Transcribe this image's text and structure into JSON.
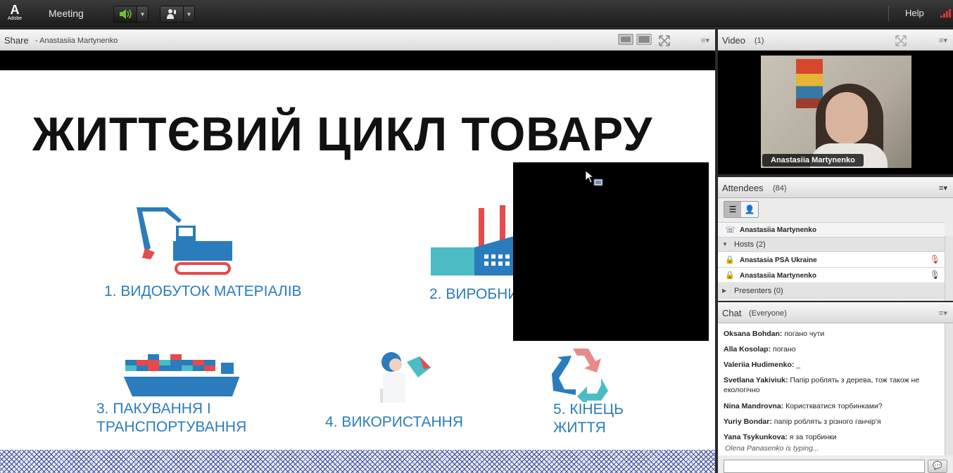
{
  "topbar": {
    "logo_text": "Adobe",
    "meeting_menu": "Meeting",
    "help_menu": "Help",
    "icons": {
      "speaker": "speaker-icon",
      "presenter": "raise-hand-icon",
      "signal": "connection-signal-icon"
    }
  },
  "share": {
    "title": "Share",
    "subtitle": "- Anastasiia Martynenko",
    "slide_title": "ЖИТТЄВИЙ ЦИКЛ ТОВАРУ",
    "stages": [
      {
        "label": "1. ВИДОБУТОК МАТЕРІАЛІВ"
      },
      {
        "label": "2. ВИРОБНИ"
      },
      {
        "label_line1": "3. ПАКУВАННЯ І",
        "label_line2": "ТРАНСПОРТУВАННЯ"
      },
      {
        "label": "4. ВИКОРИСТАННЯ"
      },
      {
        "label_line1": "5. КІНЕЦЬ",
        "label_line2": "ЖИТТЯ"
      }
    ]
  },
  "video": {
    "title": "Video",
    "count": "(1)",
    "name_tag": "Anastasiia Martynenko"
  },
  "attendees": {
    "title": "Attendees",
    "count": "(84)",
    "phone_user": "Anastasiia Martynenko",
    "hosts_label": "Hosts (2)",
    "hosts": [
      {
        "name": "Anastasia PSA Ukraine",
        "mic": "mic-muted-icon"
      },
      {
        "name": "Anastasiia Martynenko",
        "mic": "mic-active-icon"
      }
    ],
    "presenters_label": "Presenters (0)"
  },
  "chat": {
    "title": "Chat",
    "scope": "(Everyone)",
    "messages": [
      {
        "author": "Oksana Bohdan:",
        "text": " погано чути"
      },
      {
        "author": "Alla Kosolap:",
        "text": " погано"
      },
      {
        "author": "Valeriia Hudimenko:",
        "text": " _"
      },
      {
        "author": "Svetlana Yakiviuk:",
        "text": " Папір роблять з дерева, тож також не екологічно"
      },
      {
        "author": "Nina Mandrovna:",
        "text": " Користкватися торбинками?"
      },
      {
        "author": "Yuriy Bondar:",
        "text": " папір роблять з різного ганчір'я"
      },
      {
        "author": "Yana Tsykunkova:",
        "text": " я за торбинки"
      }
    ],
    "typing": "Olena Panasenko is typing..."
  },
  "colors": {
    "accent": "#2a7cbd",
    "speaker_active": "#6ec02a",
    "signal": "#dd3333"
  }
}
